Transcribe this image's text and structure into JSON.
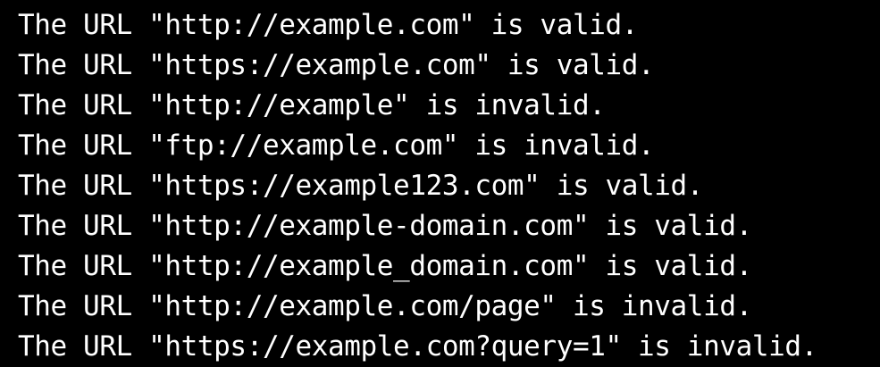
{
  "terminal": {
    "background": "#000000",
    "foreground": "#ffffff",
    "lines": [
      "The URL \"http://example.com\" is valid.",
      "The URL \"https://example.com\" is valid.",
      "The URL \"http://example\" is invalid.",
      "The URL \"ftp://example.com\" is invalid.",
      "The URL \"https://example123.com\" is valid.",
      "The URL \"http://example-domain.com\" is valid.",
      "The URL \"http://example_domain.com\" is valid.",
      "The URL \"http://example.com/page\" is invalid.",
      "The URL \"https://example.com?query=1\" is invalid."
    ]
  }
}
